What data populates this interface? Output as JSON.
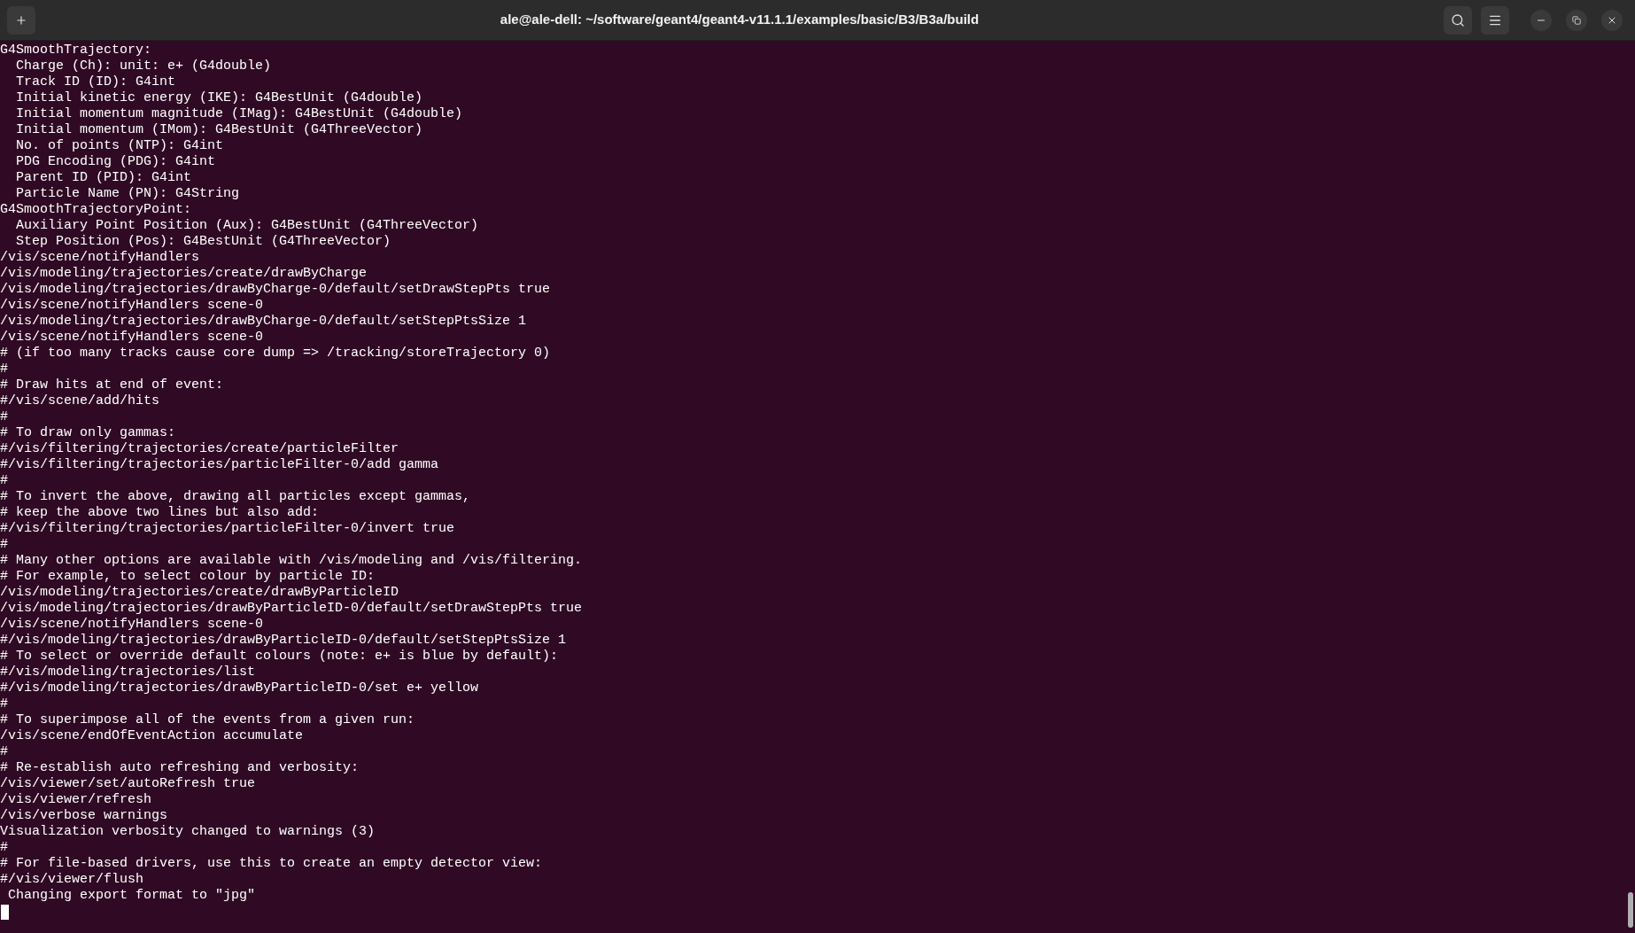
{
  "window": {
    "title": "ale@ale-dell: ~/software/geant4/geant4-v11.1.1/examples/basic/B3/B3a/build"
  },
  "terminal": {
    "lines": [
      "G4SmoothTrajectory:",
      "  Charge (Ch): unit: e+ (G4double)",
      "  Track ID (ID): G4int",
      "  Initial kinetic energy (IKE): G4BestUnit (G4double)",
      "  Initial momentum magnitude (IMag): G4BestUnit (G4double)",
      "  Initial momentum (IMom): G4BestUnit (G4ThreeVector)",
      "  No. of points (NTP): G4int",
      "  PDG Encoding (PDG): G4int",
      "  Parent ID (PID): G4int",
      "  Particle Name (PN): G4String",
      "G4SmoothTrajectoryPoint:",
      "  Auxiliary Point Position (Aux): G4BestUnit (G4ThreeVector)",
      "  Step Position (Pos): G4BestUnit (G4ThreeVector)",
      "/vis/scene/notifyHandlers",
      "/vis/modeling/trajectories/create/drawByCharge",
      "/vis/modeling/trajectories/drawByCharge-0/default/setDrawStepPts true",
      "/vis/scene/notifyHandlers scene-0",
      "/vis/modeling/trajectories/drawByCharge-0/default/setStepPtsSize 1",
      "/vis/scene/notifyHandlers scene-0",
      "# (if too many tracks cause core dump => /tracking/storeTrajectory 0)",
      "#",
      "# Draw hits at end of event:",
      "#/vis/scene/add/hits",
      "#",
      "# To draw only gammas:",
      "#/vis/filtering/trajectories/create/particleFilter",
      "#/vis/filtering/trajectories/particleFilter-0/add gamma",
      "#",
      "# To invert the above, drawing all particles except gammas,",
      "# keep the above two lines but also add:",
      "#/vis/filtering/trajectories/particleFilter-0/invert true",
      "#",
      "# Many other options are available with /vis/modeling and /vis/filtering.",
      "# For example, to select colour by particle ID:",
      "/vis/modeling/trajectories/create/drawByParticleID",
      "/vis/modeling/trajectories/drawByParticleID-0/default/setDrawStepPts true",
      "/vis/scene/notifyHandlers scene-0",
      "#/vis/modeling/trajectories/drawByParticleID-0/default/setStepPtsSize 1",
      "# To select or override default colours (note: e+ is blue by default):",
      "#/vis/modeling/trajectories/list",
      "#/vis/modeling/trajectories/drawByParticleID-0/set e+ yellow",
      "#",
      "# To superimpose all of the events from a given run:",
      "/vis/scene/endOfEventAction accumulate",
      "#",
      "# Re-establish auto refreshing and verbosity:",
      "/vis/viewer/set/autoRefresh true",
      "/vis/viewer/refresh",
      "/vis/verbose warnings",
      "Visualization verbosity changed to warnings (3)",
      "#",
      "# For file-based drivers, use this to create an empty detector view:",
      "#/vis/viewer/flush",
      " Changing export format to \"jpg\""
    ]
  }
}
